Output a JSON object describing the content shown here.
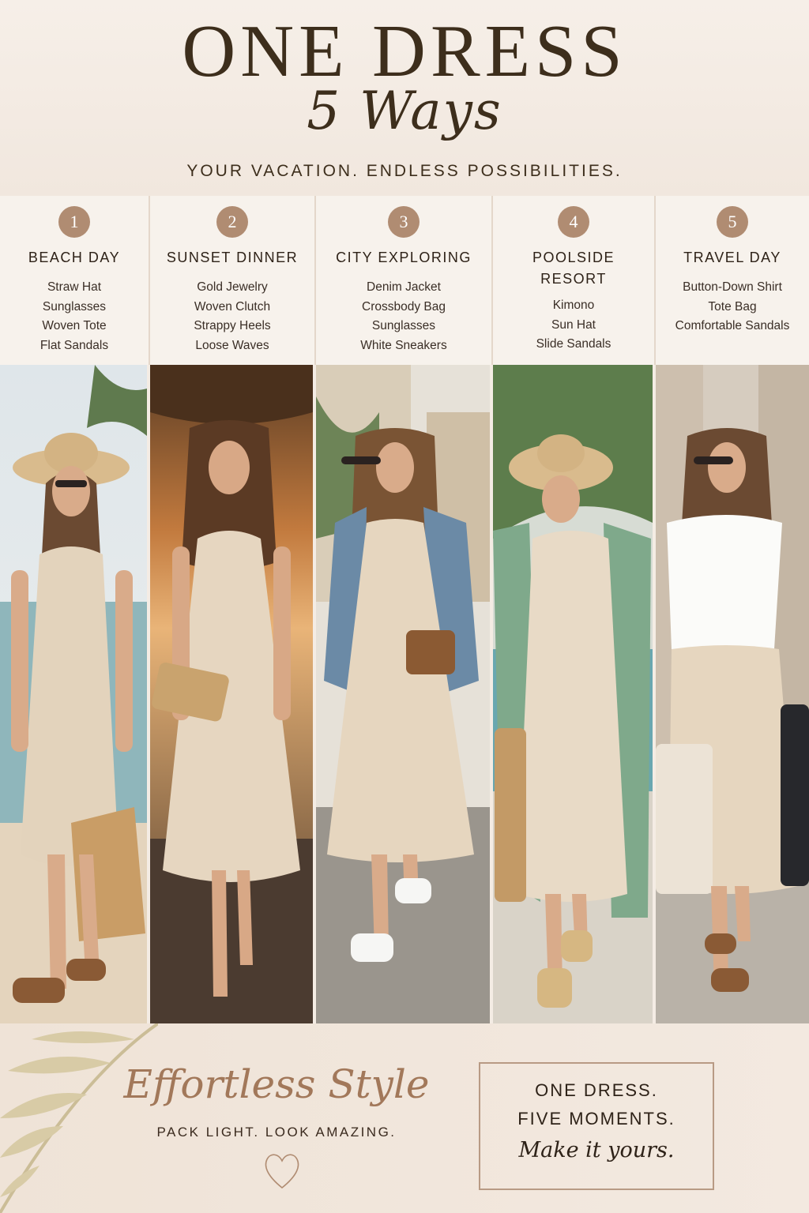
{
  "header": {
    "title": "ONE DRESS",
    "subtitle": "5 Ways",
    "tagline": "YOUR VACATION. ENDLESS POSSIBILITIES."
  },
  "looks": [
    {
      "number": "1",
      "title": "BEACH DAY",
      "items": [
        "Straw Hat",
        "Sunglasses",
        "Woven Tote",
        "Flat Sandals"
      ]
    },
    {
      "number": "2",
      "title": "SUNSET DINNER",
      "items": [
        "Gold Jewelry",
        "Woven Clutch",
        "Strappy Heels",
        "Loose Waves"
      ]
    },
    {
      "number": "3",
      "title": "CITY EXPLORING",
      "items": [
        "Denim Jacket",
        "Crossbody Bag",
        "Sunglasses",
        "White Sneakers"
      ]
    },
    {
      "number": "4",
      "title": "POOLSIDE RESORT",
      "items": [
        "Kimono",
        "Sun Hat",
        "Slide Sandals"
      ]
    },
    {
      "number": "5",
      "title": "TRAVEL DAY",
      "items": [
        "Button-Down Shirt",
        "Tote Bag",
        "Comfortable Sandals"
      ]
    }
  ],
  "footer": {
    "script": "Effortless Style",
    "tagline": "PACK LIGHT. LOOK AMAZING.",
    "box_line1": "ONE DRESS.",
    "box_line2": "FIVE MOMENTS.",
    "box_script": "Make it yours."
  },
  "colors": {
    "accent": "#b08c72",
    "text_dark": "#3d2e1c",
    "background": "#f4ece4",
    "dress": "#e3d3bc"
  }
}
